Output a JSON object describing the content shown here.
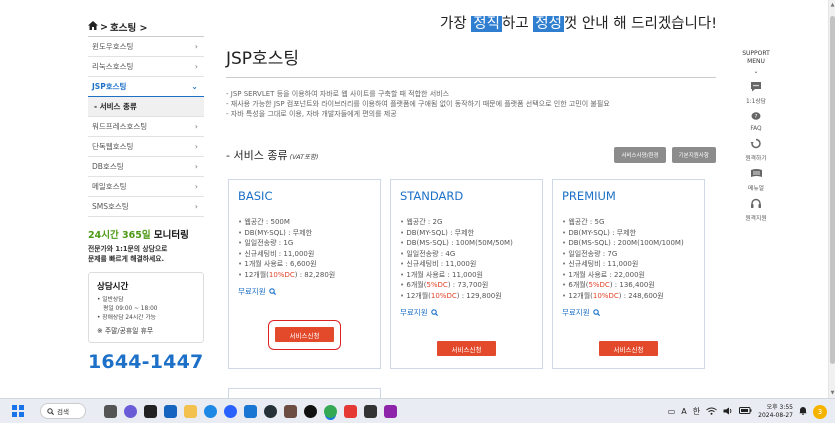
{
  "breadcrumb": {
    "home_icon": "home-icon",
    "separator": ">",
    "current": "호스팅 >"
  },
  "slogan": {
    "part1": "가장 ",
    "hl1": "정직",
    "part2": "하고 ",
    "hl2": "정성",
    "part3": "껏 안내 해 드리겠습니다!"
  },
  "sidebar": {
    "items": [
      {
        "label": "윈도우호스팅",
        "chevron": "›"
      },
      {
        "label": "리눅스호스팅",
        "chevron": "›"
      },
      {
        "label": "JSP호스팅",
        "chevron": "⌄"
      },
      {
        "label": "워드프레스호스팅",
        "chevron": "›"
      },
      {
        "label": "단독웹호스팅",
        "chevron": "›"
      },
      {
        "label": "DB호스팅",
        "chevron": "›"
      },
      {
        "label": "메일호스팅",
        "chevron": "›"
      },
      {
        "label": "SMS호스팅",
        "chevron": "›"
      }
    ],
    "sub_item": "- 서비스 종류",
    "monitor": {
      "green": "24시간 365일",
      "rest": " 모니터링",
      "desc1": "전문가와 1:1문의 상담으로",
      "desc2": "문제를 빠르게 해결하세요."
    },
    "hours": {
      "title": "상담시간",
      "line1": "• 일반상담",
      "line2": "평일 09:00 ~ 18:00",
      "line3": "• 장애상담 24시간 가능",
      "closed": "※ 주말/공휴일 휴무"
    },
    "phone": "1644-1447"
  },
  "main": {
    "title": "JSP호스팅",
    "desc": [
      "- JSP SERVLET 등을 이용하여 자바로 웹 사이트를 구축할 때 적합한 서비스",
      "- 재사용 가능한 JSP 컴포넌트와 라이브러리를 이용하여 플랫폼에 구애됨 없이 동작하기 때문에 플랫폼 선택으로 인한 고민이 불필요",
      "- 자바 특성을 그대로 이용, 자바 개발자들에게 편의를 제공"
    ],
    "section_title": "- 서비스 종류",
    "section_note": "(VAT포함)",
    "btn_spec": "서비스사양/환경",
    "btn_support": "기본지원사항"
  },
  "plans": [
    {
      "name": "BASIC",
      "features": [
        {
          "text": "웹공간 : 500M"
        },
        {
          "text": "DB(MY-SQL) : 무제한"
        },
        {
          "text": "일일전송량 : 1G"
        },
        {
          "text": "신규세팅비 : 11,000원"
        },
        {
          "text": "1개월 사용료 : 6,600원"
        },
        {
          "pre": "12개월(",
          "red": "10%DC",
          "post": ") : 82,280원"
        }
      ],
      "free_trial": "무료지원",
      "apply": "서비스신청"
    },
    {
      "name": "STANDARD",
      "features": [
        {
          "text": "웹공간 : 2G"
        },
        {
          "text": "DB(MY-SQL) : 무제한"
        },
        {
          "text": "DB(MS-SQL) : 100M(50M/50M)"
        },
        {
          "text": "일일전송량 : 4G"
        },
        {
          "text": "신규세팅비 : 11,000원"
        },
        {
          "text": "1개월 사용료 : 11,000원"
        },
        {
          "pre": "6개월(",
          "red": "5%DC",
          "post": ") : 73,700원"
        },
        {
          "pre": "12개월(",
          "red": "10%DC",
          "post": ") : 129,800원"
        }
      ],
      "free_trial": "무료지원",
      "apply": "서비스신청"
    },
    {
      "name": "PREMIUM",
      "features": [
        {
          "text": "웹공간 : 5G"
        },
        {
          "text": "DB(MY-SQL) : 무제한"
        },
        {
          "text": "DB(MS-SQL) : 200M(100M/100M)"
        },
        {
          "text": "일일전송량 : 7G"
        },
        {
          "text": "신규세팅비 : 11,000원"
        },
        {
          "text": "1개월 사용료 : 22,000원"
        },
        {
          "pre": "6개월(",
          "red": "5%DC",
          "post": ") : 136,400원"
        },
        {
          "pre": "12개월(",
          "red": "10%DC",
          "post": ") : 248,600원"
        }
      ],
      "free_trial": "무료지원",
      "apply": "서비스신청"
    }
  ],
  "support": {
    "head1": "SUPPORT",
    "head2": "MENU",
    "chevron": "⌄",
    "items": [
      {
        "label": "1:1상담",
        "icon": "chat-icon"
      },
      {
        "label": "FAQ",
        "icon": "faq-icon"
      },
      {
        "label": "원격하기",
        "icon": "remote-icon"
      },
      {
        "label": "메뉴얼",
        "icon": "manual-icon"
      },
      {
        "label": "원격지원",
        "icon": "headset-icon"
      }
    ]
  },
  "taskbar": {
    "search_label": "검색",
    "tray_lang1": "A",
    "tray_lang2": "한",
    "time": "오후 3:55",
    "date": "2024-08-27",
    "badge": "3"
  },
  "colors": {
    "accent": "#1c70c7",
    "apply": "#e24a2b",
    "monitor_green": "#4d9a16",
    "highlight": "#2f7ed0"
  }
}
